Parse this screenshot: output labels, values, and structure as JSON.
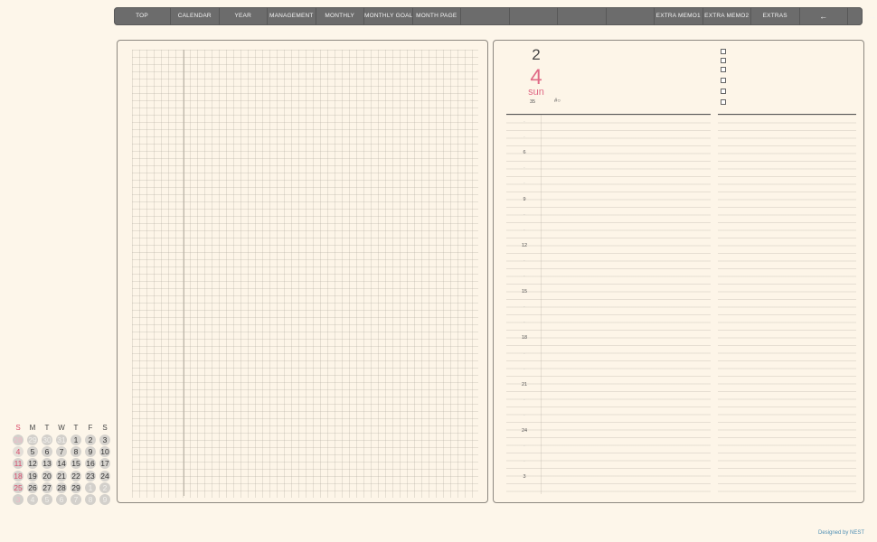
{
  "nav": {
    "tabs": [
      "TOP",
      "CALENDAR",
      "YEAR",
      "MANAGEMENT",
      "MONTHLY",
      "MONTHLY GOAL",
      "MONTH PAGE",
      "",
      "",
      "",
      "",
      "EXTRA MEMO1",
      "EXTRA MEMO2",
      "EXTRAS",
      "←",
      "→"
    ]
  },
  "day_page": {
    "month": "2",
    "day": "4",
    "weekday": "sun",
    "week_number": "35",
    "extra_mark": "#○",
    "checklist_count": 6,
    "hours": [
      "·",
      "·",
      "6",
      "·",
      "·",
      "9",
      "·",
      "·",
      "12",
      "·",
      "·",
      "15",
      "·",
      "·",
      "18",
      "·",
      "·",
      "21",
      "·",
      "·",
      "24",
      "·",
      "·",
      "3"
    ]
  },
  "mini_calendar": {
    "weekday_headers": [
      "S",
      "M",
      "T",
      "W",
      "T",
      "F",
      "S"
    ],
    "weeks": [
      [
        {
          "d": "28",
          "o": true
        },
        {
          "d": "29",
          "o": true
        },
        {
          "d": "30",
          "o": true
        },
        {
          "d": "31",
          "o": true
        },
        {
          "d": "1"
        },
        {
          "d": "2"
        },
        {
          "d": "3"
        }
      ],
      [
        {
          "d": "4",
          "today": true
        },
        {
          "d": "5"
        },
        {
          "d": "6"
        },
        {
          "d": "7"
        },
        {
          "d": "8"
        },
        {
          "d": "9"
        },
        {
          "d": "10"
        }
      ],
      [
        {
          "d": "11"
        },
        {
          "d": "12"
        },
        {
          "d": "13"
        },
        {
          "d": "14"
        },
        {
          "d": "15"
        },
        {
          "d": "16"
        },
        {
          "d": "17"
        }
      ],
      [
        {
          "d": "18"
        },
        {
          "d": "19"
        },
        {
          "d": "20"
        },
        {
          "d": "21"
        },
        {
          "d": "22"
        },
        {
          "d": "23"
        },
        {
          "d": "24"
        }
      ],
      [
        {
          "d": "25"
        },
        {
          "d": "26"
        },
        {
          "d": "27"
        },
        {
          "d": "28"
        },
        {
          "d": "29"
        },
        {
          "d": "1",
          "o": true
        },
        {
          "d": "2",
          "o": true
        }
      ],
      [
        {
          "d": "3",
          "o": true
        },
        {
          "d": "4",
          "o": true
        },
        {
          "d": "5",
          "o": true
        },
        {
          "d": "6",
          "o": true
        },
        {
          "d": "7",
          "o": true
        },
        {
          "d": "8",
          "o": true
        },
        {
          "d": "9",
          "o": true
        }
      ]
    ]
  },
  "footer": {
    "credit": "Designed by NEST"
  },
  "colors": {
    "background": "#fdf6ea",
    "nav": "#6c6c6c",
    "accent_pink": "#e06a86",
    "credit_blue": "#4f8fb4"
  }
}
